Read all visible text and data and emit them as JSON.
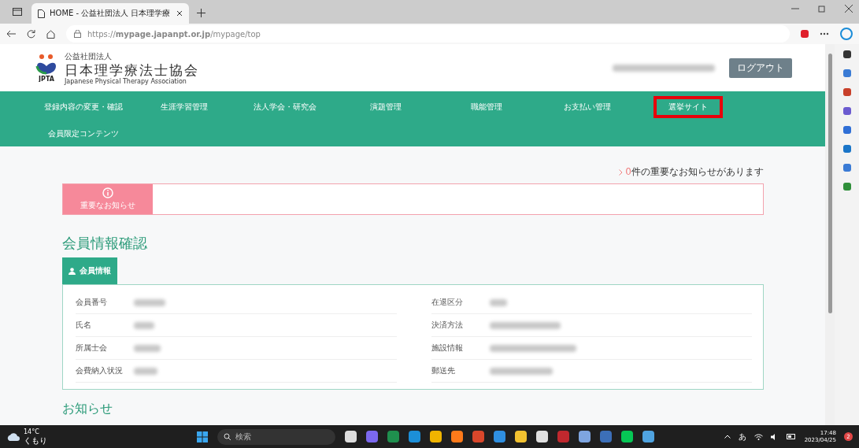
{
  "browser": {
    "tab_title": "HOME - 公益社団法人 日本理学療",
    "url": "https://**mypage.japanpt.or.jp**/mypage/top"
  },
  "header": {
    "logo_text": "JPTA",
    "org_type": "公益社団法人",
    "org_name": "日本理学療法士協会",
    "org_en": "Japanese Physical Therapy Association",
    "logout": "ログアウト"
  },
  "nav": [
    {
      "label": "登録内容の変更・確認",
      "highlighted": false
    },
    {
      "label": "生涯学習管理",
      "highlighted": false
    },
    {
      "label": "法人学会・研究会",
      "highlighted": false
    },
    {
      "label": "演題管理",
      "highlighted": false
    },
    {
      "label": "職能管理",
      "highlighted": false
    },
    {
      "label": "お支払い管理",
      "highlighted": false
    },
    {
      "label": "選挙サイト",
      "highlighted": true
    },
    {
      "label": "会員限定コンテンツ",
      "highlighted": false
    }
  ],
  "notice": {
    "count": "0",
    "text": "件の重要なお知らせがあります",
    "alert_label": "重要なお知らせ"
  },
  "member": {
    "title": "会員情報確認",
    "tab": "会員情報",
    "left": [
      "会員番号",
      "氏名",
      "所属士会",
      "会費納入状況"
    ],
    "right": [
      "在退区分",
      "決済方法",
      "施設情報",
      "郵送先"
    ]
  },
  "next_section": "お知らせ",
  "taskbar": {
    "temp": "14°C",
    "weather": "くもり",
    "search": "検索",
    "ime": "あ",
    "time": "17:48",
    "date": "2023/04/25",
    "badge": "2",
    "apps": [
      {
        "color": "#dddddd"
      },
      {
        "color": "#7b68ee"
      },
      {
        "color": "#1f8f4e"
      },
      {
        "color": "#1c8fd8"
      },
      {
        "color": "#f0b400"
      },
      {
        "color": "#ff7a1a"
      },
      {
        "color": "#d9472b"
      },
      {
        "color": "#2f8fe0"
      },
      {
        "color": "#f2c230"
      },
      {
        "color": "#e0e0e0"
      },
      {
        "color": "#c0282e"
      },
      {
        "color": "#7ea5e0"
      },
      {
        "color": "#3c6fb8"
      },
      {
        "color": "#06c755"
      },
      {
        "color": "#4fa3e0"
      }
    ]
  }
}
